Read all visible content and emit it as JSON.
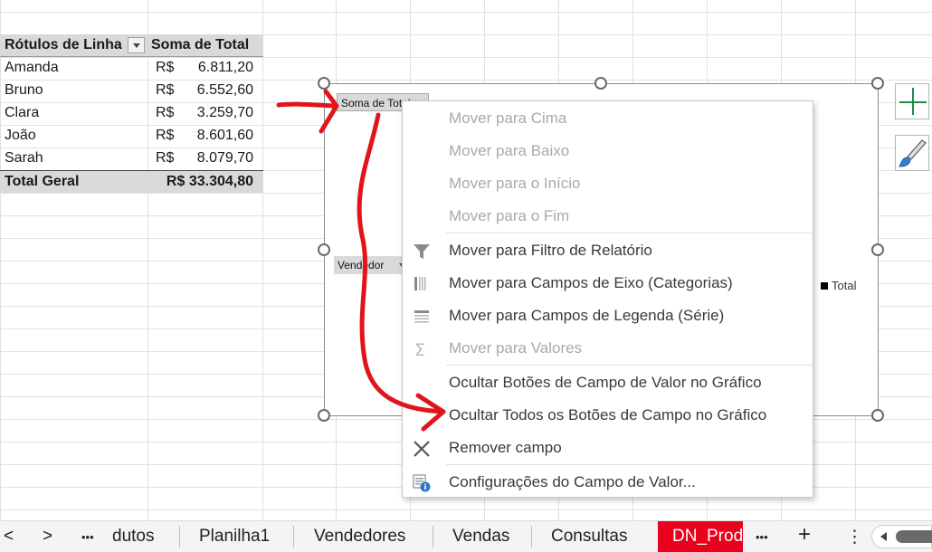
{
  "pivot": {
    "header_rows": "Rótulos de Linha",
    "header_sum": "Soma de Total",
    "rows": [
      {
        "name": "Amanda",
        "currency": "R$",
        "amount": "6.811,20"
      },
      {
        "name": "Bruno",
        "currency": "R$",
        "amount": "6.552,60"
      },
      {
        "name": "Clara",
        "currency": "R$",
        "amount": "3.259,70"
      },
      {
        "name": "João",
        "currency": "R$",
        "amount": "8.601,60"
      },
      {
        "name": "Sarah",
        "currency": "R$",
        "amount": "8.079,70"
      }
    ],
    "total_label": "Total Geral",
    "total_value": "R$ 33.304,80"
  },
  "chart": {
    "field_value": "Soma de Total",
    "field_axis": "Vendedor",
    "legend": "Total"
  },
  "menu": {
    "items": [
      {
        "label": "Mover para Cima",
        "disabled": true
      },
      {
        "label": "Mover para Baixo",
        "disabled": true
      },
      {
        "label": "Mover para o Início",
        "disabled": true
      },
      {
        "label": "Mover para o Fim",
        "disabled": true
      },
      {
        "label": "Mover para Filtro de Relatório",
        "icon": "filter-icon",
        "disabled": false
      },
      {
        "label": "Mover para Campos de Eixo (Categorias)",
        "icon": "axis-fields-icon",
        "disabled": false
      },
      {
        "label": "Mover para Campos de Legenda (Série)",
        "icon": "legend-fields-icon",
        "disabled": false
      },
      {
        "label": "Mover para Valores",
        "icon": "sigma-icon",
        "disabled": true
      },
      {
        "label": "Ocultar Botões de Campo de Valor no Gráfico",
        "disabled": false
      },
      {
        "label": "Ocultar Todos os Botões de Campo no Gráfico",
        "disabled": false
      },
      {
        "label": "Remover campo",
        "icon": "remove-x-icon",
        "disabled": false
      },
      {
        "label": "Configurações do Campo de Valor...",
        "icon": "field-settings-icon",
        "disabled": false
      }
    ]
  },
  "sheets": {
    "nav_prev": "<",
    "nav_next": ">",
    "more_left": "•••",
    "tab_partial": "dutos",
    "tabs": [
      "Planilha1",
      "Vendedores",
      "Vendas",
      "Consultas"
    ],
    "active_tab": "DN_Prod",
    "more_right": "•••",
    "add": "+",
    "options": "⋮"
  },
  "colors": {
    "active_tab": "#e8001c",
    "annotation": "#e0151c",
    "chart_plus": "#1f8a47"
  }
}
